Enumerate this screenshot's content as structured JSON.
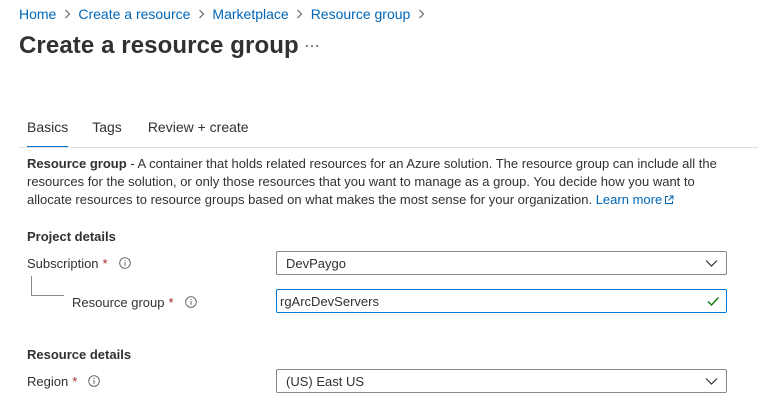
{
  "breadcrumb": {
    "items": [
      {
        "label": "Home"
      },
      {
        "label": "Create a resource"
      },
      {
        "label": "Marketplace"
      },
      {
        "label": "Resource group"
      }
    ]
  },
  "page": {
    "title": "Create a resource group",
    "more_label": "..."
  },
  "tabs": [
    {
      "label": "Basics",
      "active": true
    },
    {
      "label": "Tags",
      "active": false
    },
    {
      "label": "Review + create",
      "active": false
    }
  ],
  "description": {
    "lead": "Resource group",
    "text": " - A container that holds related resources for an Azure solution. The resource group can include all the resources for the solution, or only those resources that you want to manage as a group. You decide how you want to allocate resources to resource groups based on what makes the most sense for your organization. ",
    "link": "Learn more"
  },
  "project_details": {
    "heading": "Project details",
    "subscription": {
      "label": "Subscription",
      "required_mark": "*",
      "value": "DevPaygo"
    },
    "resource_group": {
      "label": "Resource group",
      "required_mark": "*",
      "value": "rgArcDevServers"
    }
  },
  "resource_details": {
    "heading": "Resource details",
    "region": {
      "label": "Region",
      "required_mark": "*",
      "value": "(US) East US"
    }
  },
  "colors": {
    "link": "#0067b8",
    "accent": "#0078d4",
    "required": "#a4262c",
    "valid": "#107c10"
  },
  "icons": {
    "info": "info-icon",
    "chevron": "chevron-down-icon",
    "check": "checkmark-icon",
    "external": "external-link-icon"
  }
}
